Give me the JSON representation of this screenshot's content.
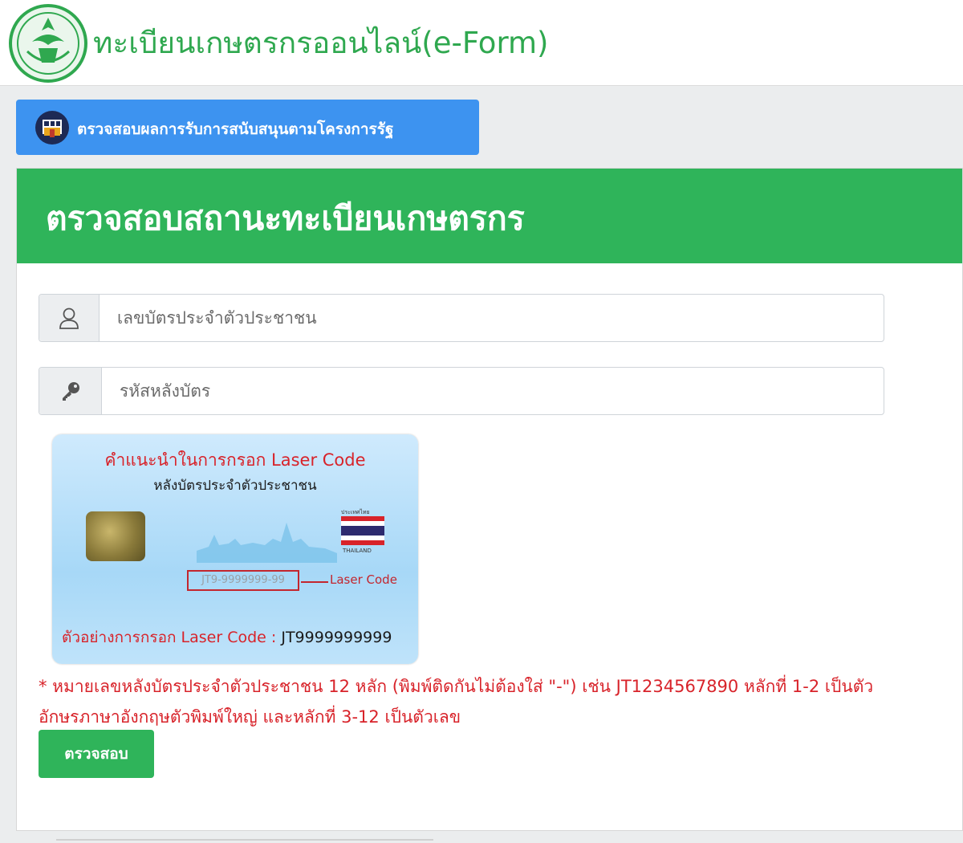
{
  "header": {
    "site_title": "ทะเบียนเกษตรกรออนไลน์(e-Form)",
    "logo_icon": "agriculture-ministry-seal-icon"
  },
  "support_button": {
    "label": "ตรวจสอบผลการรับการสนับสนุนตามโครงการรัฐ",
    "icon": "bank-building-icon"
  },
  "panel": {
    "title": "ตรวจสอบสถานะทะเบียนเกษตรกร",
    "id_input": {
      "placeholder": "เลขบัตรประจำตัวประชาชน",
      "value": "",
      "icon": "user-icon"
    },
    "laser_input": {
      "placeholder": "รหัสหลังบัตร",
      "value": "",
      "icon": "key-icon"
    },
    "card_guide": {
      "title": "คำแนะนำในการกรอก Laser Code",
      "subtitle": "หลังบัตรประจำตัวประชาชน",
      "flag_caption": "ประเทศไทย",
      "flag_country": "THAILAND",
      "laser_sample": "JT9-9999999-99",
      "laser_label": "Laser Code",
      "example_label": "ตัวอย่างการกรอก Laser Code :",
      "example_value": "JT9999999999"
    },
    "note": "* หมายเลขหลังบัตรประจำตัวประชาชน 12 หลัก (พิมพ์ติดกันไม่ต้องใส่ \"-\") เช่น JT1234567890 หลักที่ 1-2 เป็นตัวอักษรภาษาอังกฤษตัวพิมพ์ใหญ่ และหลักที่ 3-12 เป็นตัวเลข",
    "submit_label": "ตรวจสอบ"
  },
  "colors": {
    "brand_green": "#2fb45a",
    "title_green": "#2fa84f",
    "button_blue": "#3d93f0",
    "note_red": "#d8232a"
  }
}
